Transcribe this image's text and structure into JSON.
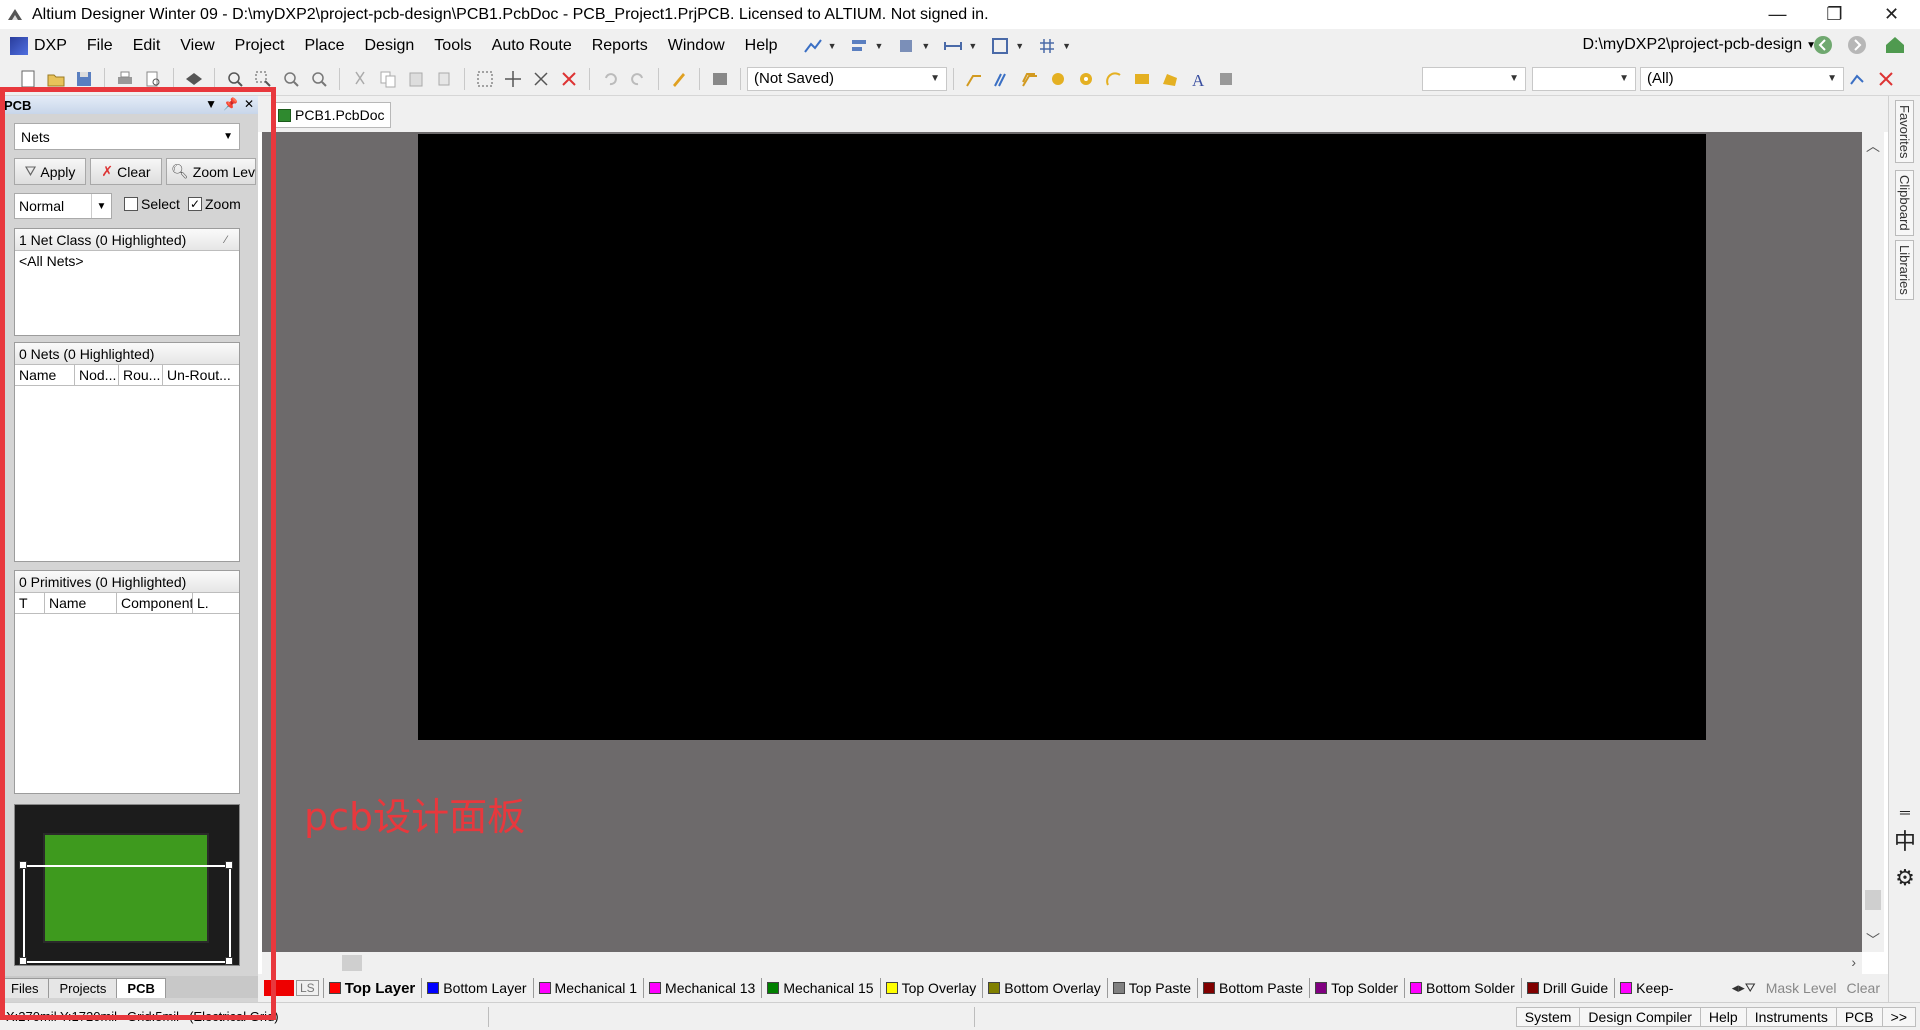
{
  "window": {
    "title": "Altium Designer Winter 09 - D:\\myDXP2\\project-pcb-design\\PCB1.PcbDoc - PCB_Project1.PrjPCB. Licensed to ALTIUM. Not signed in.",
    "controls": {
      "minimize": "—",
      "restore": "❐",
      "close": "✕"
    }
  },
  "menu": {
    "items": [
      "DXP",
      "File",
      "Edit",
      "View",
      "Project",
      "Place",
      "Design",
      "Tools",
      "Auto Route",
      "Reports",
      "Window",
      "Help"
    ],
    "path": "D:\\myDXP2\\project-pcb-design"
  },
  "toolbar": {
    "saved_state": "(Not Saved)",
    "filter_all": "(All)"
  },
  "panel": {
    "title": "PCB",
    "mode_combo": "Nets",
    "buttons": {
      "apply": "Apply",
      "clear": "Clear",
      "zoom": "Zoom Lev"
    },
    "mask_mode": "Normal",
    "checks": {
      "select": "Select",
      "zoom": "Zoom"
    },
    "netclass": {
      "title": "1 Net Class (0 Highlighted)",
      "rows": [
        "<All Nets>"
      ]
    },
    "nets": {
      "title": "0 Nets (0 Highlighted)",
      "columns": [
        "Name",
        "Nod...",
        "Rou...",
        "Un-Rout..."
      ]
    },
    "primitives": {
      "title": "0 Primitives (0 Highlighted)",
      "columns": [
        "T",
        "Name",
        "Component",
        "L."
      ]
    },
    "tabs": [
      "Files",
      "Projects",
      "PCB"
    ]
  },
  "annotation": "pcb设计面板",
  "document": {
    "tab": "PCB1.PcbDoc"
  },
  "right_tabs": [
    "Favorites",
    "Clipboard",
    "Libraries"
  ],
  "right_icons": {
    "ime": "中",
    "settings": "⚙"
  },
  "layers": {
    "ls": "LS",
    "tabs": [
      {
        "name": "Top Layer",
        "color": "#ff0000"
      },
      {
        "name": "Bottom Layer",
        "color": "#0000ff"
      },
      {
        "name": "Mechanical 1",
        "color": "#ff00ff"
      },
      {
        "name": "Mechanical 13",
        "color": "#ff00ff"
      },
      {
        "name": "Mechanical 15",
        "color": "#008000"
      },
      {
        "name": "Top Overlay",
        "color": "#ffff00"
      },
      {
        "name": "Bottom Overlay",
        "color": "#808000"
      },
      {
        "name": "Top Paste",
        "color": "#808080"
      },
      {
        "name": "Bottom Paste",
        "color": "#800000"
      },
      {
        "name": "Top Solder",
        "color": "#800080"
      },
      {
        "name": "Bottom Solder",
        "color": "#ff00ff"
      },
      {
        "name": "Drill Guide",
        "color": "#800000"
      },
      {
        "name": "Keep-",
        "color": "#ff00ff"
      }
    ],
    "mask_level": "Mask Level",
    "clear": "Clear"
  },
  "status": {
    "coords": "X:270mil Y:1720mil",
    "grid": "Grid:5mil",
    "electrical": "(Electrical Grid)",
    "right_buttons": [
      "System",
      "Design Compiler",
      "Help",
      "Instruments",
      "PCB",
      ">>"
    ]
  }
}
